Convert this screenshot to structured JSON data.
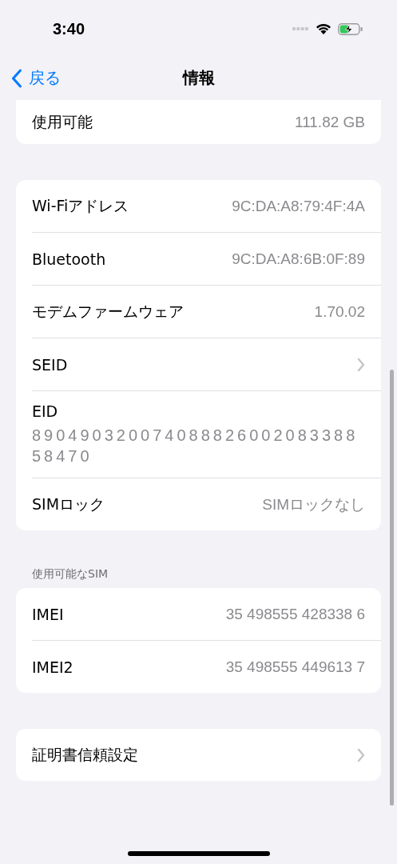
{
  "status_bar": {
    "time": "3:40"
  },
  "nav": {
    "back": "戻る",
    "title": "情報"
  },
  "groups": [
    {
      "cut_top": true,
      "rows": [
        {
          "kind": "value",
          "label": "使用可能",
          "value": "111.82 GB"
        }
      ]
    },
    {
      "cut_top": false,
      "rows": [
        {
          "kind": "value",
          "label": "Wi-Fiアドレス",
          "value": "9C:DA:A8:79:4F:4A"
        },
        {
          "kind": "value",
          "label": "Bluetooth",
          "value": "9C:DA:A8:6B:0F:89"
        },
        {
          "kind": "value",
          "label": "モデムファームウェア",
          "value": "1.70.02"
        },
        {
          "kind": "chevron",
          "label": "SEID"
        },
        {
          "kind": "stacked",
          "label": "EID",
          "value": "89049032007408882600208338858470"
        },
        {
          "kind": "value",
          "label": "SIMロック",
          "value": "SIMロックなし"
        }
      ]
    },
    {
      "cut_top": false,
      "header": "使用可能なSIM",
      "rows": [
        {
          "kind": "value",
          "label": "IMEI",
          "value": "35 498555 428338 6"
        },
        {
          "kind": "value",
          "label": "IMEI2",
          "value": "35 498555 449613 7"
        }
      ]
    },
    {
      "cut_top": false,
      "rows": [
        {
          "kind": "chevron",
          "label": "証明書信頼設定"
        }
      ]
    }
  ]
}
